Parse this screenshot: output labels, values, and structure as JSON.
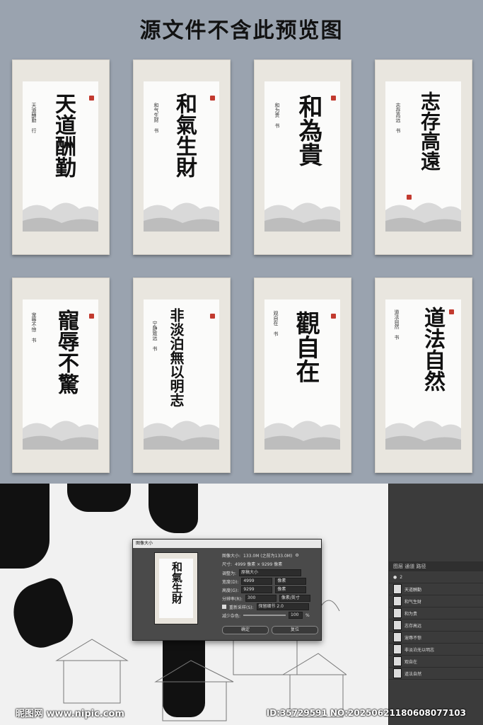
{
  "banner": {
    "title": "源文件不含此预览图"
  },
  "scrolls": [
    {
      "main": "天道酬勤",
      "side": "天道酬勤 行"
    },
    {
      "main": "和氣生財",
      "side": "和气生财 书"
    },
    {
      "main": "和為貴",
      "side": "和为贵 书"
    },
    {
      "main": "志存高遠",
      "side": "志存高远 书"
    },
    {
      "main": "寵辱不驚",
      "side": "宠辱不惊 书"
    },
    {
      "main": "非淡泊無以明志",
      "side": "宁静致远 书"
    },
    {
      "main": "觀自在",
      "side": "观自在 书"
    },
    {
      "main": "道法自然",
      "side": "道法自然 书"
    }
  ],
  "dialog": {
    "title": "图像大小",
    "preview_text": "和氣生財",
    "image_size_label": "图像大小:",
    "image_size_value": "133.0M (之前为133.0M)",
    "dimensions_label": "尺寸:",
    "dimensions_value": "4999 像素 × 9299 像素",
    "fit_label": "调整为:",
    "fit_value": "原稿大小",
    "width_label": "宽度(D):",
    "width_value": "4999",
    "width_unit": "像素",
    "height_label": "高度(G):",
    "height_value": "9299",
    "height_unit": "像素",
    "res_label": "分辨率(R):",
    "res_value": "300",
    "res_unit": "像素/英寸",
    "resample_label": "重新采样(S):",
    "resample_value": "保留细节 2.0",
    "noise_label": "减少杂色:",
    "noise_value": "100",
    "noise_unit": "%",
    "ok": "确定",
    "cancel": "复位"
  },
  "layers": {
    "tabs": "图层  通道  路径",
    "items": [
      "2",
      "天道酬勤",
      "和气生财",
      "和为贵",
      "志存高远",
      "宠辱不惊",
      "非淡泊无以明志",
      "观自在",
      "道法自然"
    ]
  },
  "watermark": {
    "left": "昵图网 www.nipic.com",
    "right": "ID:35729591 NO:20250621180608077103"
  }
}
